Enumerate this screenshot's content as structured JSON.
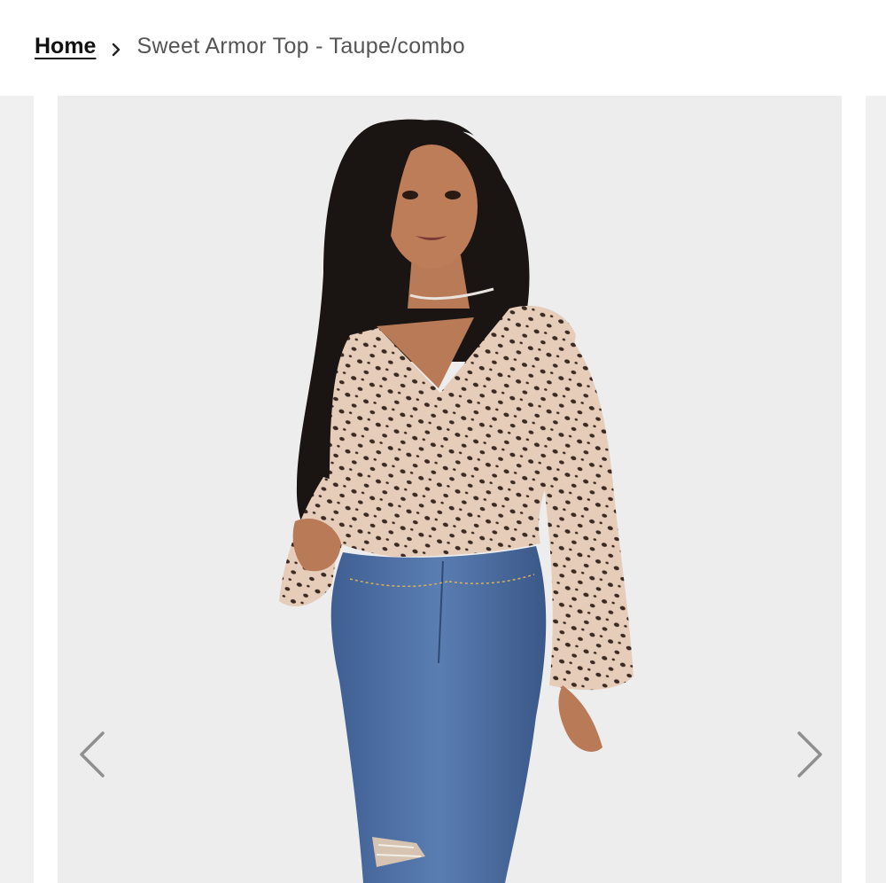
{
  "breadcrumb": {
    "home_label": "Home",
    "separator_icon": "chevron-right-icon",
    "current_label": "Sweet Armor Top - Taupe/combo"
  },
  "product_image": {
    "alt": "Sweet Armor Top - Taupe/combo",
    "prev_icon": "chevron-left-icon",
    "next_icon": "chevron-right-icon"
  },
  "colors": {
    "top_base": "#e6cdb9",
    "spots": "#3a2a22",
    "denim": "#4f72a6",
    "hair": "#1a1412",
    "skin": "#b97a57",
    "background": "#eeeded"
  }
}
